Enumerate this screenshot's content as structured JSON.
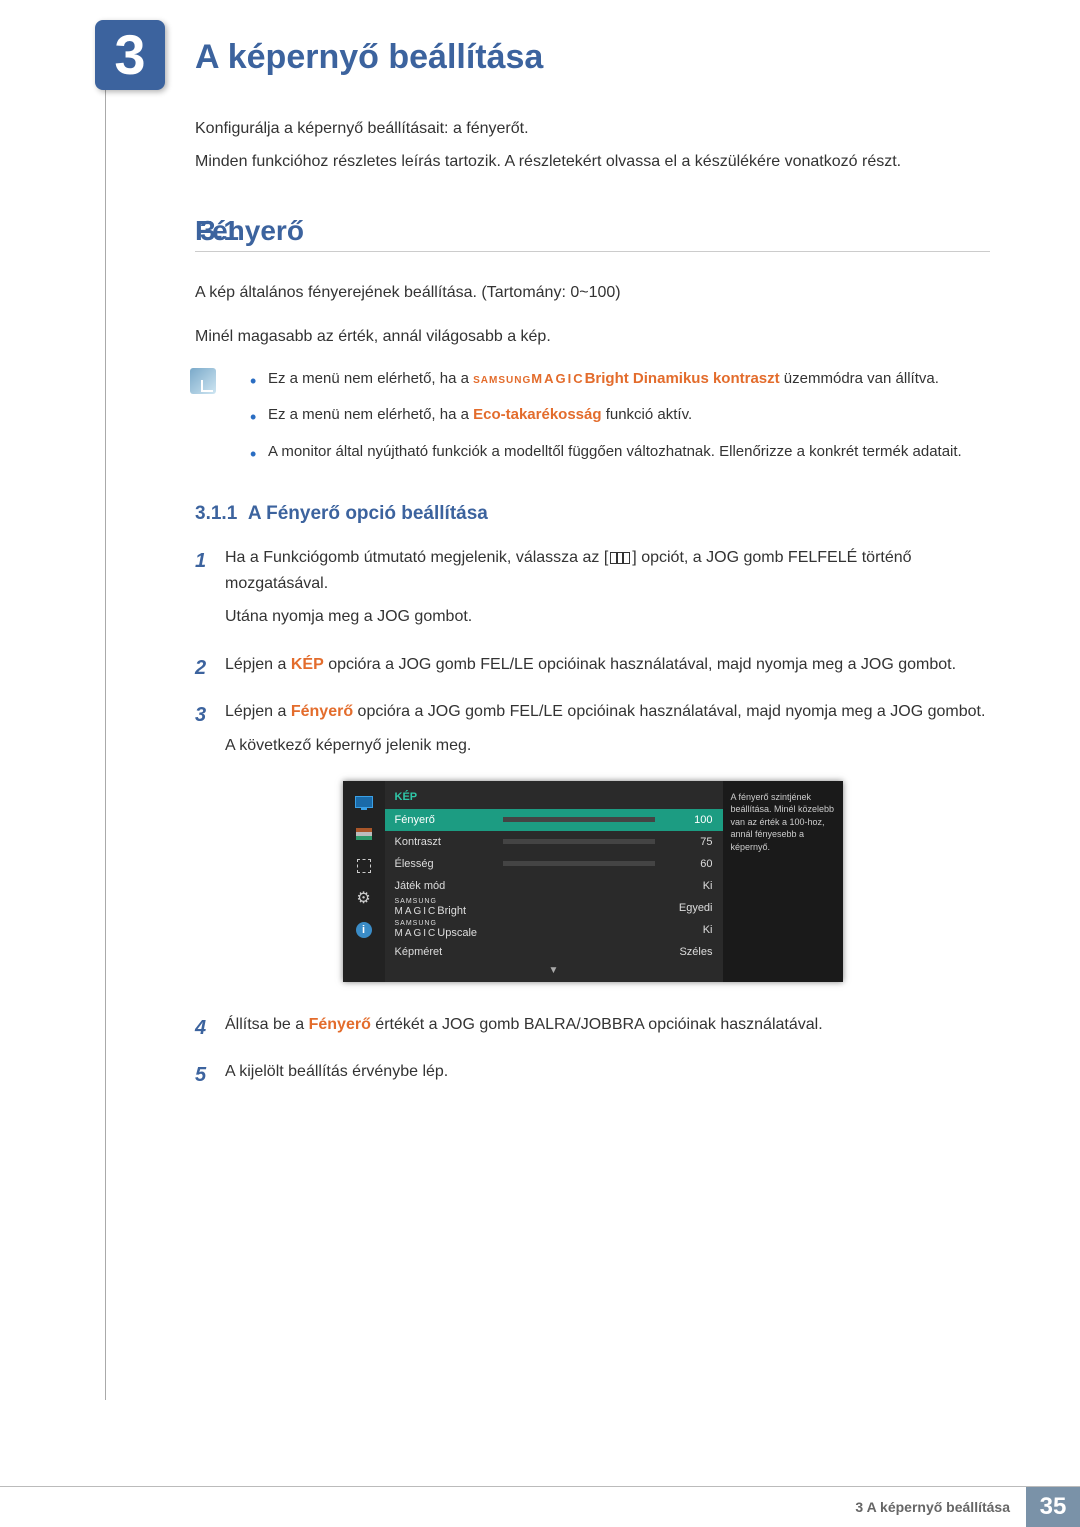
{
  "chapter": {
    "number": "3",
    "title": "A képernyő beállítása"
  },
  "intro": {
    "p1": "Konfigurálja a képernyő beállításait: a fényerőt.",
    "p2": "Minden funkcióhoz részletes leírás tartozik. A részletekért olvassa el a készülékére vonatkozó részt."
  },
  "section": {
    "number": "3.1",
    "title": "Fényerő"
  },
  "body": {
    "p1": "A kép általános fényerejének beállítása. (Tartomány: 0~100)",
    "p2": "Minél magasabb az érték, annál világosabb a kép."
  },
  "notes": {
    "n1a": "Ez a menü nem elérhető, ha a ",
    "n1_magic_small": "SAMSUNG",
    "n1_magic_big": "MAGIC",
    "n1_bright": "Bright",
    "n1_dk": " Dinamikus kontraszt",
    "n1b": " üzemmódra van állítva.",
    "n2a": "Ez a menü nem elérhető, ha a ",
    "n2_eco": "Eco-takarékosság",
    "n2b": " funkció aktív.",
    "n3": "A monitor által nyújtható funkciók a modelltől függően változhatnak. Ellenőrizze a konkrét termék adatait."
  },
  "subsection": {
    "number": "3.1.1",
    "title": "A Fényerő opció beállítása"
  },
  "steps": {
    "s1a": "Ha a Funkciógomb útmutató megjelenik, válassza az [",
    "s1b": "] opciót, a JOG gomb FELFELÉ történő mozgatásával.",
    "s1c": "Utána nyomja meg a JOG gombot.",
    "s2a": "Lépjen a ",
    "s2_kep": "KÉP",
    "s2b": " opcióra a JOG gomb FEL/LE opcióinak használatával, majd nyomja meg a JOG gombot.",
    "s3a": "Lépjen a ",
    "s3_fenyero": "Fényerő",
    "s3b": " opcióra a JOG gomb FEL/LE opcióinak használatával, majd nyomja meg a JOG gombot.",
    "s3c": "A következő képernyő jelenik meg.",
    "s4a": "Állítsa be a ",
    "s4_fenyero": "Fényerő",
    "s4b": " értékét a JOG gomb BALRA/JOBBRA opcióinak használatával.",
    "s5": "A kijelölt beállítás érvénybe lép."
  },
  "osd": {
    "header": "KÉP",
    "desc": "A fényerő szintjének beállítása. Minél közelebb van az érték a 100-hoz, annál fényesebb a képernyő.",
    "rows": [
      {
        "label": "Fényerő",
        "value": "100",
        "bar": 100,
        "selected": true,
        "barColor": "green"
      },
      {
        "label": "Kontraszt",
        "value": "75",
        "bar": 75,
        "barColor": "gray"
      },
      {
        "label": "Élesség",
        "value": "60",
        "bar": 60,
        "barColor": "gray"
      },
      {
        "label": "Játék mód",
        "value": "Ki"
      },
      {
        "label_magic": "Bright",
        "value": "Egyedi"
      },
      {
        "label_magic": "Upscale",
        "value": "Ki"
      },
      {
        "label": "Képméret",
        "value": "Széles"
      }
    ],
    "magic_small": "SAMSUNG",
    "magic_big": "MAGIC"
  },
  "footer": {
    "text": "3 A képernyő beállítása",
    "page": "35"
  }
}
